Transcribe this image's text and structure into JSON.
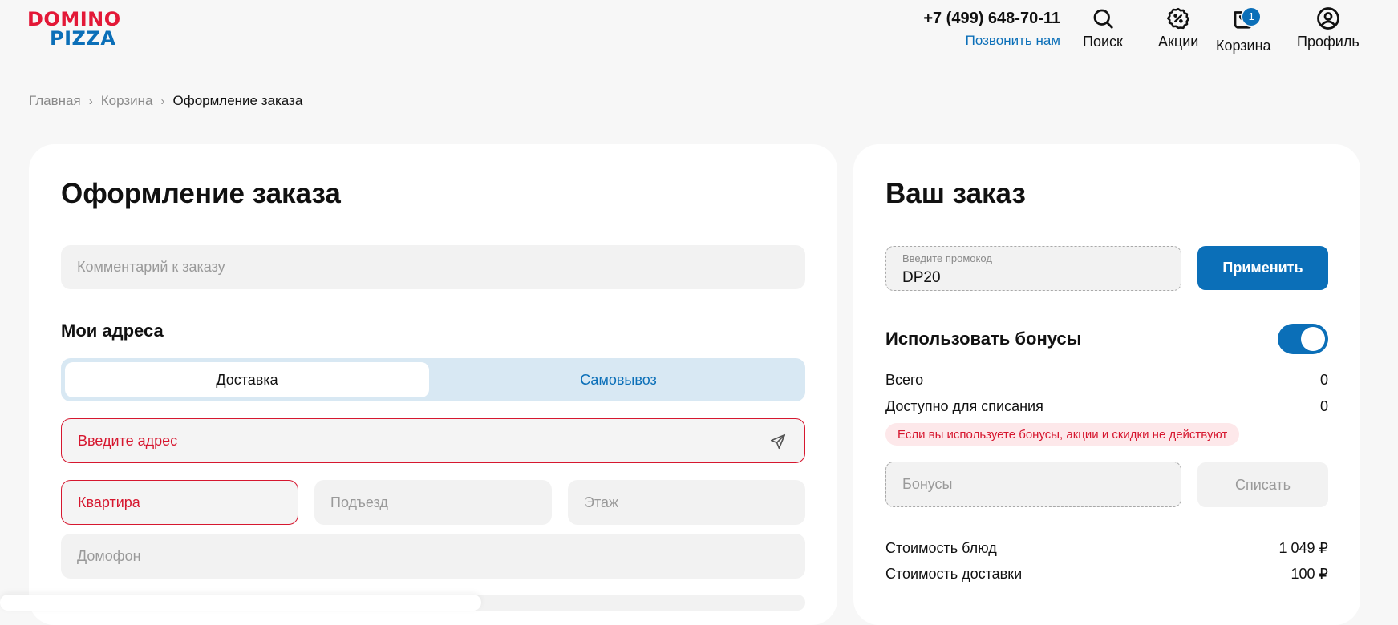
{
  "header": {
    "logo": {
      "line1": "DOMINO",
      "line2": "PIZZA"
    },
    "phone": "+7 (499) 648-70-11",
    "call_link": "Позвонить нам",
    "nav": {
      "search": "Поиск",
      "promos": "Акции",
      "cart": "Корзина",
      "cart_badge": "1",
      "profile": "Профиль"
    }
  },
  "breadcrumb": {
    "home": "Главная",
    "cart": "Корзина",
    "current": "Оформление заказа"
  },
  "checkout": {
    "title": "Оформление заказа",
    "comment_placeholder": "Комментарий к заказу",
    "addresses_title": "Мои адреса",
    "tabs": {
      "delivery": "Доставка",
      "pickup": "Самовывоз"
    },
    "address_placeholder": "Введите адрес",
    "apartment_placeholder": "Квартира",
    "entrance_placeholder": "Подъезд",
    "floor_placeholder": "Этаж",
    "intercom_placeholder": "Домофон"
  },
  "order": {
    "title": "Ваш заказ",
    "promo_label": "Введите промокод",
    "promo_value": "DP20",
    "apply_button": "Применить",
    "use_bonuses_label": "Использовать бонусы",
    "use_bonuses_on": true,
    "total_label": "Всего",
    "total_value": "0",
    "available_label": "Доступно для списания",
    "available_value": "0",
    "warning": "Если вы используете бонусы, акции и скидки не действуют",
    "bonus_placeholder": "Бонусы",
    "writeoff_button": "Списать",
    "dishes_cost_label": "Стоимость блюд",
    "dishes_cost_value": "1 049 ₽",
    "delivery_cost_label": "Стоимость доставки",
    "delivery_cost_value": "100 ₽"
  },
  "colors": {
    "brand_red": "#e31837",
    "brand_blue": "#0b6fb8",
    "error": "#d6172f",
    "background": "#f7f7f7"
  }
}
